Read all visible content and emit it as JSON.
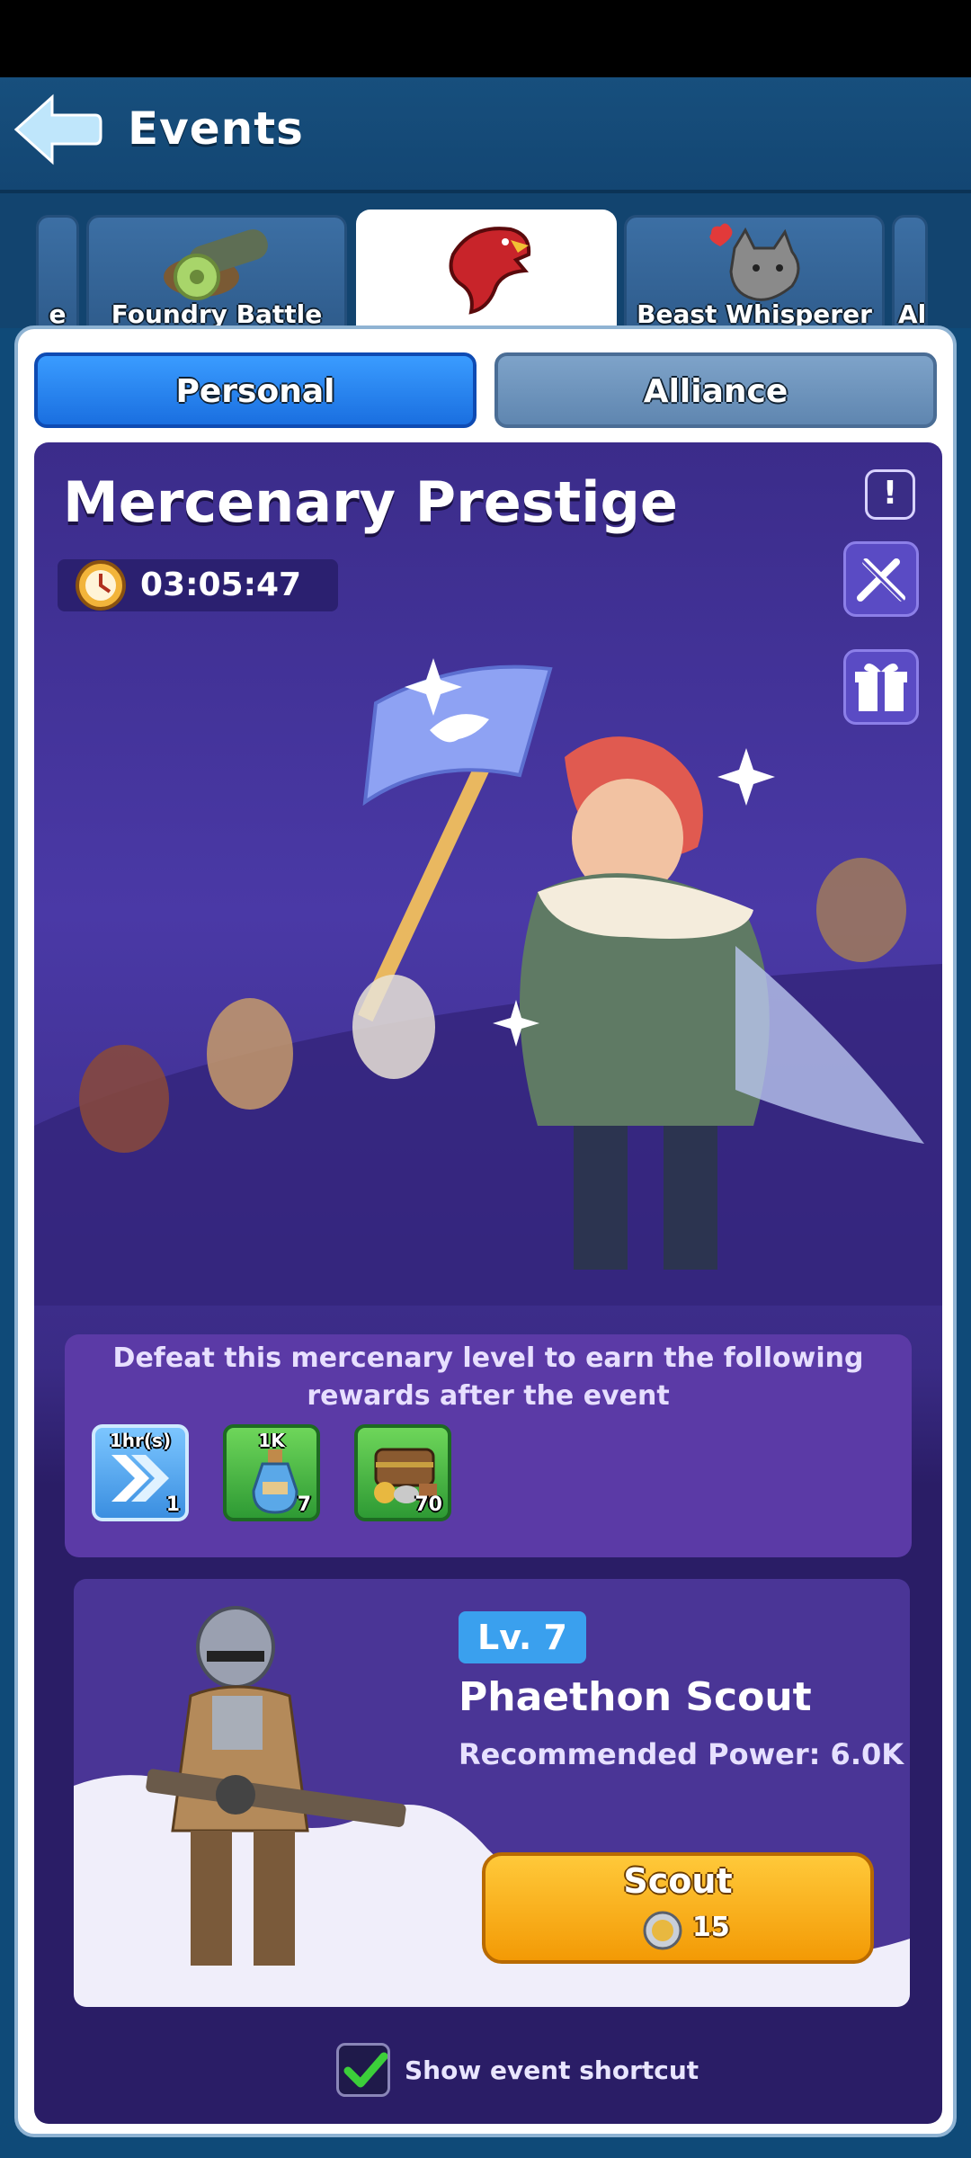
{
  "header": {
    "title": "Events",
    "back_icon": "back-arrow-icon"
  },
  "tabs": [
    {
      "label": "e",
      "icon": "partial-tab-icon",
      "active": false
    },
    {
      "label": "Foundry Battle",
      "icon": "cannon-icon",
      "active": false
    },
    {
      "label": "",
      "icon": "eagle-emblem-icon",
      "active": true
    },
    {
      "label": "Beast Whisperer",
      "icon": "wolf-heart-icon",
      "active": false
    },
    {
      "label": "Al",
      "icon": "partial-tab-icon",
      "active": false
    }
  ],
  "segments": {
    "personal": "Personal",
    "alliance": "Alliance",
    "selected": "Personal"
  },
  "event": {
    "title": "Mercenary Prestige",
    "timer": "03:05:47",
    "rewards_description": "Defeat this mercenary level to earn the following rewards after the event",
    "rewards": [
      {
        "icon": "speedup-icon",
        "top_label": "1hr(s)",
        "count": "1",
        "color": "#4aa3e8"
      },
      {
        "icon": "exp-potion-icon",
        "top_label": "1K",
        "count": "7",
        "color": "#3cb043"
      },
      {
        "icon": "resource-chest-icon",
        "top_label": "",
        "count": "70",
        "color": "#3cb043"
      }
    ]
  },
  "enemy": {
    "level": "Lv. 7",
    "name": "Phaethon Scout",
    "power": "Recommended Power: 6.0K",
    "action": "Scout",
    "cost": "15"
  },
  "shortcut": {
    "label": "Show event shortcut",
    "checked": true
  },
  "colors": {
    "accent": "#1a6fe0",
    "scout": "#f7a912",
    "card": "#3b2c8a"
  }
}
